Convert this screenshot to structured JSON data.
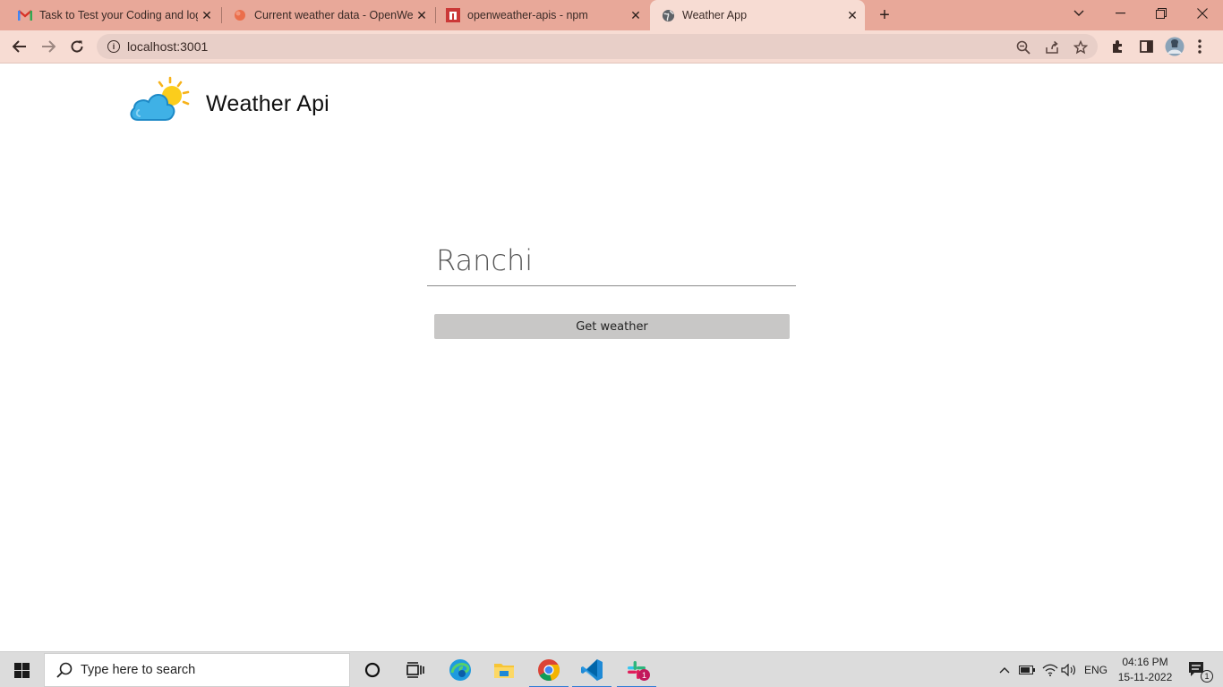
{
  "browser": {
    "tabs": [
      {
        "title": "Task to Test your Coding and log",
        "icon": "gmail-icon",
        "active": false
      },
      {
        "title": "Current weather data - OpenWea",
        "icon": "openweather-icon",
        "active": false
      },
      {
        "title": "openweather-apis - npm",
        "icon": "npm-icon",
        "active": false
      },
      {
        "title": "Weather App",
        "icon": "globe-icon",
        "active": true
      }
    ],
    "new_tab": "+",
    "address": "localhost:3001"
  },
  "page": {
    "brand": "Weather Api",
    "city_value": "Ranchi",
    "get_button": "Get weather"
  },
  "taskbar": {
    "search_placeholder": "Type here to search",
    "language": "ENG",
    "time": "04:16 PM",
    "date": "15-11-2022",
    "notification_count": "1",
    "slack_badge": "1"
  },
  "colors": {
    "tabstrip": "#e8a899",
    "toolbar": "#f7dcd3",
    "button": "#c8c7c6"
  }
}
